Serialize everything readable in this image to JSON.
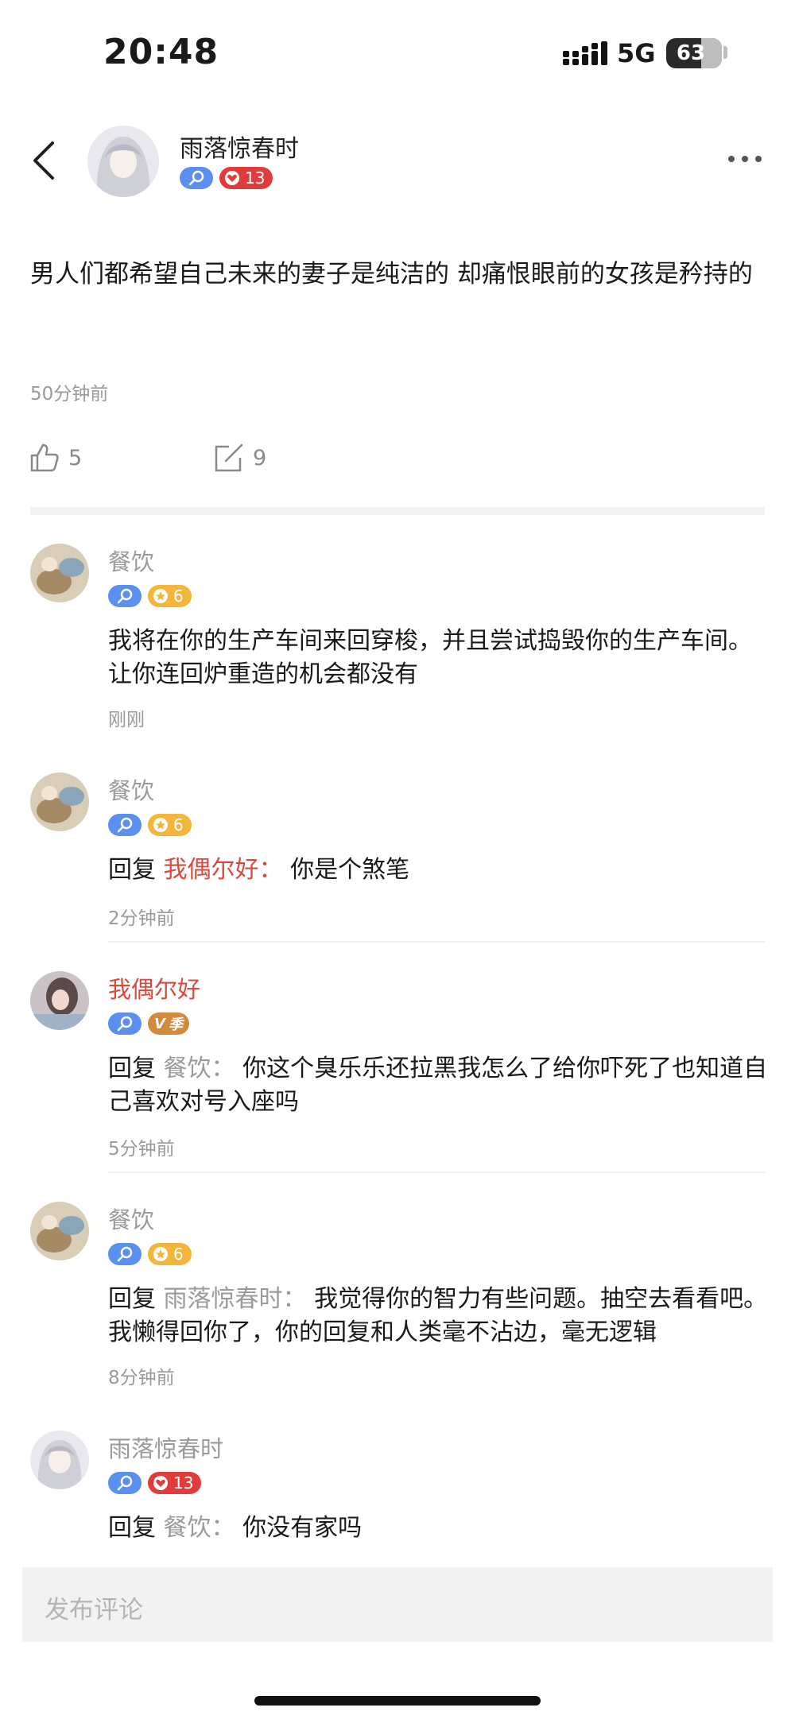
{
  "status_bar": {
    "time": "20:48",
    "network": "5G",
    "battery": "63"
  },
  "post": {
    "author": "雨落惊春时",
    "author_badge_level": "13",
    "text": "男人们都希望自己未来的妻子是纯洁的 却痛恨眼前的女孩是矜持的",
    "time": "50分钟前",
    "likes": "5",
    "comments": "9"
  },
  "comments": [
    {
      "name": "餐饮",
      "badge_type": "gold",
      "badge_level": "6",
      "reply_word": "",
      "reply_target": "",
      "text": "我将在你的生产车间来回穿梭，并且尝试捣毁你的生产车间。让你连回炉重造的机会都没有",
      "time": "刚刚"
    },
    {
      "name": "餐饮",
      "badge_type": "gold",
      "badge_level": "6",
      "reply_word": "回复",
      "reply_target": "我偶尔好：",
      "text": "你是个煞笔",
      "time": "2分钟前"
    },
    {
      "name": "我偶尔好",
      "badge_type": "vip",
      "badge_level": "季",
      "reply_word": "回复",
      "reply_target": "餐饮：",
      "text": "你这个臭乐乐还拉黑我怎么了给你吓死了也知道自己喜欢对号入座吗",
      "time": "5分钟前"
    },
    {
      "name": "餐饮",
      "badge_type": "gold",
      "badge_level": "6",
      "reply_word": "回复",
      "reply_target": "雨落惊春时：",
      "text": "我觉得你的智力有些问题。抽空去看看吧。我懒得回你了，你的回复和人类毫不沾边，毫无逻辑",
      "time": "8分钟前"
    },
    {
      "name": "雨落惊春时",
      "badge_type": "red",
      "badge_level": "13",
      "reply_word": "回复",
      "reply_target": "餐饮：",
      "text": "你没有家吗",
      "time": ""
    }
  ],
  "comment_input": {
    "placeholder": "发布评论"
  },
  "icons": {
    "back": "chevron-left-icon",
    "more": "more-dots-icon",
    "like": "thumbs-up-icon",
    "comment": "edit-comment-icon"
  },
  "colors": {
    "accent_red": "#d94a3d",
    "badge_blue": "#5b8ff0",
    "badge_red": "#e23b3b",
    "badge_gold": "#f3b53a"
  }
}
